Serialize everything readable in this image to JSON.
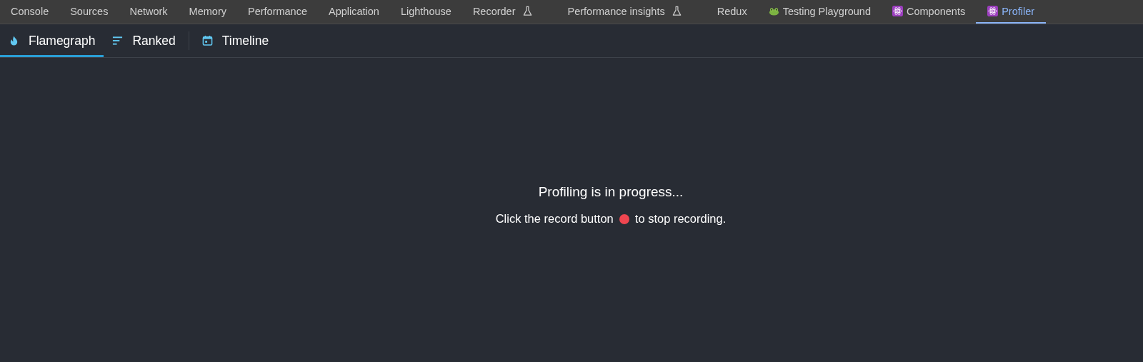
{
  "devtools_tabs": [
    {
      "label": "Console",
      "kind": "plain",
      "selected": false
    },
    {
      "label": "Sources",
      "kind": "plain",
      "selected": false
    },
    {
      "label": "Network",
      "kind": "plain",
      "selected": false
    },
    {
      "label": "Memory",
      "kind": "plain",
      "selected": false
    },
    {
      "label": "Performance",
      "kind": "plain",
      "selected": false
    },
    {
      "label": "Application",
      "kind": "plain",
      "selected": false
    },
    {
      "label": "Lighthouse",
      "kind": "plain",
      "selected": false
    },
    {
      "label": "Recorder",
      "kind": "experiment",
      "selected": false
    },
    {
      "label": "Performance insights",
      "kind": "experiment",
      "selected": false
    },
    {
      "label": "Redux",
      "kind": "plain",
      "selected": false
    },
    {
      "label": "Testing Playground",
      "kind": "frog",
      "selected": false
    },
    {
      "label": "Components",
      "kind": "react",
      "selected": false
    },
    {
      "label": "Profiler",
      "kind": "react",
      "selected": true
    }
  ],
  "profiler_tabs": [
    {
      "label": "Flamegraph",
      "kind": "flame",
      "selected": true
    },
    {
      "label": "Ranked",
      "kind": "ranked",
      "selected": false
    },
    {
      "label": "Timeline",
      "kind": "timeline",
      "selected": false
    }
  ],
  "message": {
    "title": "Profiling is in progress...",
    "before_icon": "Click the record button",
    "after_icon": "to stop recording."
  }
}
